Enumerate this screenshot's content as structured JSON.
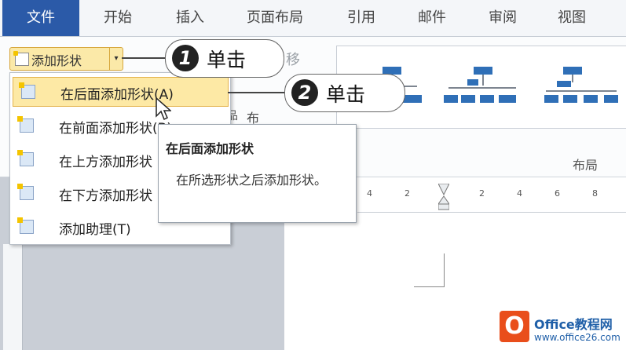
{
  "tabs": [
    "文件",
    "开始",
    "插入",
    "页面布局",
    "引用",
    "邮件",
    "审阅",
    "视图"
  ],
  "ribbon": {
    "add_shape_label": "添加形状",
    "move_label": "移",
    "partial_item_label": "布",
    "layout_group_label": "布局"
  },
  "menu": {
    "items": [
      {
        "label": "在后面添加形状(A)"
      },
      {
        "label": "在前面添加形状(B)"
      },
      {
        "label": "在上方添加形状"
      },
      {
        "label": "在下方添加形状"
      },
      {
        "label": "添加助理(T)"
      }
    ]
  },
  "tooltip": {
    "title": "在后面添加形状",
    "body": "在所选形状之后添加形状。"
  },
  "callouts": [
    {
      "number": "1",
      "text": "单击"
    },
    {
      "number": "2",
      "text": "单击"
    }
  ],
  "ruler": {
    "ticks": [
      "4",
      "2",
      "2",
      "4",
      "6",
      "8"
    ]
  },
  "watermark": {
    "title": "Office教程网",
    "url": "www.office26.com"
  }
}
